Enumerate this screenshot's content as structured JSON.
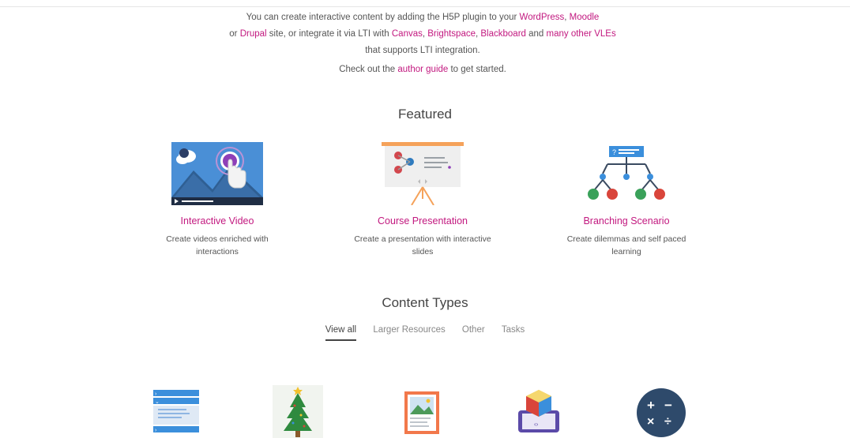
{
  "intro": {
    "t1": "You can create interactive content by adding the H5P plugin to your ",
    "l_wordpress": "WordPress",
    "t2": ", ",
    "l_moodle": "Moodle",
    "t3": "or ",
    "l_drupal": "Drupal",
    "t4": " site, or integrate it via LTI with ",
    "l_canvas": "Canvas",
    "t5": ", ",
    "l_brightspace": "Brightspace",
    "t6": ", ",
    "l_blackboard": "Blackboard",
    "t7": " and ",
    "l_many": "many other VLEs",
    "t8": " that supports LTI integration."
  },
  "guide": {
    "t1": "Check out the ",
    "link": "author guide",
    "t2": " to get started."
  },
  "featured": {
    "title": "Featured",
    "items": [
      {
        "title": "Interactive Video",
        "desc": "Create videos enriched with interactions",
        "icon": "interactive-video-icon"
      },
      {
        "title": "Course Presentation",
        "desc": "Create a presentation with interactive slides",
        "icon": "course-presentation-icon"
      },
      {
        "title": "Branching Scenario",
        "desc": "Create dilemmas and self paced learning",
        "icon": "branching-scenario-icon"
      }
    ]
  },
  "content_types": {
    "title": "Content Types",
    "tabs": [
      "View all",
      "Larger Resources",
      "Other",
      "Tasks"
    ],
    "active_tab": "View all",
    "icons": [
      "accordion-icon",
      "advent-calendar-icon",
      "agamotto-icon",
      "ar-scavenger-icon",
      "arithmetic-quiz-icon"
    ]
  },
  "colors": {
    "link": "#c2187f",
    "text": "#555555",
    "heading": "#444444"
  }
}
